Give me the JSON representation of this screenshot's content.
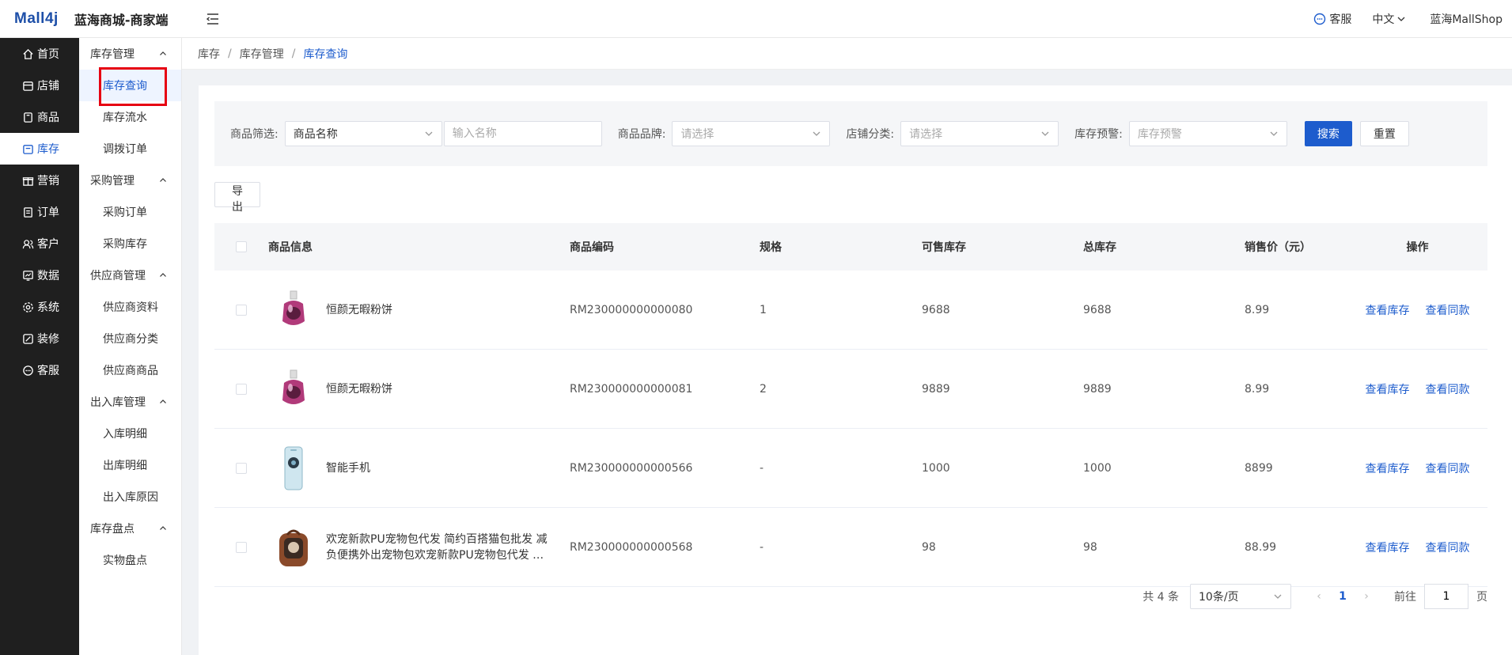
{
  "header": {
    "logo": "Mall4j",
    "app_title": "蓝海商城-商家端",
    "service": "客服",
    "language": "中文",
    "shop": "蓝海MallShop"
  },
  "nav": [
    {
      "label": "首页",
      "icon": "home-icon"
    },
    {
      "label": "店铺",
      "icon": "shop-icon"
    },
    {
      "label": "商品",
      "icon": "product-icon"
    },
    {
      "label": "库存",
      "icon": "inventory-icon",
      "active": true
    },
    {
      "label": "营销",
      "icon": "gift-icon"
    },
    {
      "label": "订单",
      "icon": "order-icon"
    },
    {
      "label": "客户",
      "icon": "customer-icon"
    },
    {
      "label": "数据",
      "icon": "data-icon"
    },
    {
      "label": "系统",
      "icon": "settings-icon"
    },
    {
      "label": "装修",
      "icon": "decorate-icon"
    },
    {
      "label": "客服",
      "icon": "chat-icon"
    }
  ],
  "subnav": {
    "g1": {
      "label": "库存管理",
      "items": [
        "库存查询",
        "库存流水",
        "调拨订单"
      ]
    },
    "g2": {
      "label": "采购管理",
      "items": [
        "采购订单",
        "采购库存"
      ]
    },
    "g3": {
      "label": "供应商管理",
      "items": [
        "供应商资料",
        "供应商分类",
        "供应商商品"
      ]
    },
    "g4": {
      "label": "出入库管理",
      "items": [
        "入库明细",
        "出库明细",
        "出入库原因"
      ]
    },
    "g5": {
      "label": "库存盘点",
      "items": [
        "实物盘点"
      ]
    }
  },
  "breadcrumb": [
    "库存",
    "库存管理",
    "库存查询"
  ],
  "filters": {
    "product_filter_label": "商品筛选:",
    "product_filter_value": "商品名称",
    "name_placeholder": "输入名称",
    "brand_label": "商品品牌:",
    "brand_placeholder": "请选择",
    "category_label": "店铺分类:",
    "category_placeholder": "请选择",
    "warning_label": "库存预警:",
    "warning_placeholder": "库存预警",
    "search": "搜索",
    "reset": "重置"
  },
  "export": "导出",
  "table": {
    "headers": [
      "商品信息",
      "商品编码",
      "规格",
      "可售库存",
      "总库存",
      "销售价（元）",
      "操作"
    ],
    "rows": [
      {
        "name": "恒颜无暇粉饼",
        "code": "RM230000000000080",
        "spec": "1",
        "sellable": "9688",
        "total": "9688",
        "price": "8.99",
        "thumb": "perfume"
      },
      {
        "name": "恒颜无暇粉饼",
        "code": "RM230000000000081",
        "spec": "2",
        "sellable": "9889",
        "total": "9889",
        "price": "8.99",
        "thumb": "perfume"
      },
      {
        "name": "智能手机",
        "code": "RM230000000000566",
        "spec": "-",
        "sellable": "1000",
        "total": "1000",
        "price": "8899",
        "thumb": "phone"
      },
      {
        "name": "欢宠新款PU宠物包代发 简约百搭猫包批发 减负便携外出宠物包欢宠新款PU宠物包代发 …",
        "code": "RM230000000000568",
        "spec": "-",
        "sellable": "98",
        "total": "98",
        "price": "88.99",
        "thumb": "petbag"
      }
    ],
    "op_view_stock": "查看库存",
    "op_view_same": "查看同款"
  },
  "pager": {
    "total": "共 4 条",
    "page_size": "10条/页",
    "current": "1",
    "goto_label": "前往",
    "goto_value": "1",
    "page_suffix": "页"
  },
  "colors": {
    "primary": "#1d5ccd",
    "sidebar_dark": "#1f1f1f",
    "highlight": "#e60012"
  }
}
